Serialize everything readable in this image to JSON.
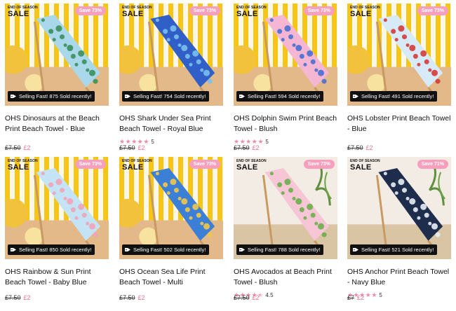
{
  "products": [
    {
      "title": "OHS Dinosaurs at the Beach Print Beach Towel - Blue",
      "sale_small": "END OF SEASON",
      "sale_big": "SALE",
      "save": "Save 73%",
      "selling": "Selling Fast! 875 Sold recently!",
      "rating": null,
      "rating_label": "",
      "old_price": "£7.50",
      "new_price": "£2",
      "towel_color": "#a8d8ea",
      "pattern_color": "#3a8f5a",
      "bg": "stripes"
    },
    {
      "title": "OHS Shark Under Sea Print Beach Towel - Royal Blue",
      "sale_small": "END OF SEASON",
      "sale_big": "SALE",
      "save": "Save 73%",
      "selling": "Selling Fast! 754 Sold recently!",
      "rating": 5,
      "rating_label": "5",
      "old_price": "£7.50",
      "new_price": "£2",
      "towel_color": "#2f5fc7",
      "pattern_color": "#7ac0f0",
      "bg": "stripes"
    },
    {
      "title": "OHS Dolphin Swim Print Beach Towel - Blush",
      "sale_small": "END OF SEASON",
      "sale_big": "SALE",
      "save": "Save 73%",
      "selling": "Selling Fast! 594 Sold recently!",
      "rating": 5,
      "rating_label": "5",
      "old_price": "£7.50",
      "new_price": "£2",
      "towel_color": "#f4b6d2",
      "pattern_color": "#4a6fd0",
      "bg": "stripes"
    },
    {
      "title": "OHS Lobster Print Beach Towel - Blue",
      "sale_small": "END OF SEASON",
      "sale_big": "SALE",
      "save": "Save 73%",
      "selling": "Selling Fast! 491 Sold recently!",
      "rating": null,
      "rating_label": "",
      "old_price": "£7.50",
      "new_price": "£2",
      "towel_color": "#d6ebf7",
      "pattern_color": "#d63a3a",
      "bg": "stripes"
    },
    {
      "title": "OHS Rainbow & Sun Print Beach Towel - Baby Blue",
      "sale_small": "END OF SEASON",
      "sale_big": "SALE",
      "save": "Save 73%",
      "selling": "Selling Fast! 850 Sold recently!",
      "rating": null,
      "rating_label": "",
      "old_price": "£7.50",
      "new_price": "£2",
      "towel_color": "#c4e4f6",
      "pattern_color": "#f2a3b8",
      "bg": "stripes"
    },
    {
      "title": "OHS Ocean Sea Life Print Beach Towel - Multi",
      "sale_small": "END OF SEASON",
      "sale_big": "SALE",
      "save": "Save 73%",
      "selling": "Selling Fast! 502 Sold recently!",
      "rating": null,
      "rating_label": "",
      "old_price": "£7.50",
      "new_price": "£2",
      "towel_color": "#3c7fd6",
      "pattern_color": "#f0c64a",
      "bg": "stripes"
    },
    {
      "title": "OHS Avocados at Beach Print Towel - Blush",
      "sale_small": "END OF SEASON",
      "sale_big": "SALE",
      "save": "Save 73%",
      "selling": "Selling Fast! 788 Sold recently!",
      "rating": 4.5,
      "rating_label": "4.5",
      "old_price": "£7.50",
      "new_price": "£2",
      "towel_color": "#f6c6d6",
      "pattern_color": "#6cae4a",
      "bg": "room"
    },
    {
      "title": "OHS Anchor Print Beach Towel - Navy Blue",
      "sale_small": "END OF SEASON",
      "sale_big": "SALE",
      "save": "Save 71%",
      "selling": "Selling Fast! 521 Sold recently!",
      "rating": 5,
      "rating_label": "5",
      "old_price": "£7",
      "new_price": "£2",
      "towel_color": "#1f2d4d",
      "pattern_color": "#e8eef6",
      "bg": "room"
    }
  ],
  "colors": {
    "accent_pink": "#f7a0bd",
    "star_pink": "#f08aa8",
    "price_pink": "#e5738f",
    "stripe_yellow": "#f5c518"
  },
  "icons": {
    "selling_badge": "tag-icon",
    "rating": "star-icon"
  }
}
